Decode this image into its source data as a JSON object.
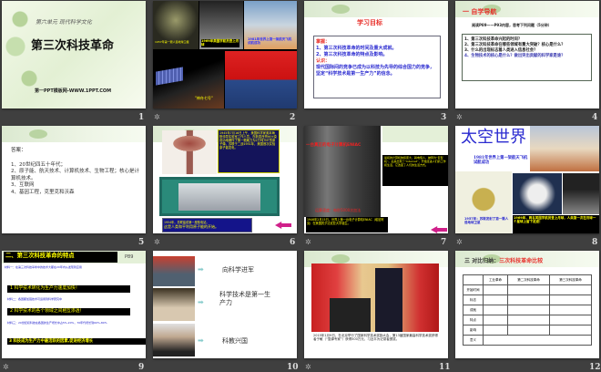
{
  "slides": [
    {
      "num": "1",
      "unit": "第六单元 现代科学文化",
      "title": "第三次科技革命",
      "site": "第一PPT模板网-WWW.1PPT.COM"
    },
    {
      "num": "2",
      "cap1": "1957年第一颗人造地球卫星",
      "cap2": "1969年美国宇航员登上月球",
      "cap3": "1981年世界上第一架航天飞机试航成功",
      "cap4": "\"神舟七号\""
    },
    {
      "num": "3",
      "title": "学习目标",
      "l1": "掌握：",
      "l2": "1、第三次科技革命的时间及重大成就。",
      "l3": "2、第三次科技革命的特点及影响。",
      "l4": "认识：",
      "l5": "现代国际间的竞争已成为以科技为先导的综合国力的竞争，坚定“科学技术是第一生产力”的信念。"
    },
    {
      "num": "4",
      "title": "一 自学导航",
      "sub": "阅读P89——P93内容，思考下列问题（5分钟）",
      "q1": "1、第三次科技革命兴起的时间？",
      "q2": "2、第三次科技革命在哪些领域有重大突破？核心是什么？",
      "q3": "3、什么的出现标志着人类进入信息社会？",
      "q4": "4、生物技术的核心是什么？做出突出贡献的科学家是谁？"
    },
    {
      "num": "5",
      "head": "答案：",
      "a1": "1、20世纪四五十年代；",
      "a2": "2、原子能、航天技术、计算机技术、生物工程；核心是计算机技术。",
      "a3": "3、互联网",
      "a4": "4、基因工程，克里克和沃森"
    },
    {
      "num": "6",
      "txt1": "1945年7月16日上午，美国科学家奥本海默领导实验室工作人员，在新墨西哥州沙漠成功地爆炸了第一颗威力为2万吨TNT的原子弹。苏联于二战1951年，美国首次实验原子能发电。",
      "txt2": "1954年，苏联建成第一座核电站。",
      "txt3": "这是人类和平利用原子能的开始。"
    },
    {
      "num": "7",
      "ttl": "一台真正的电子计算机ENIAC",
      "cap": "运算速度：每秒5000次加法",
      "txt1": "最初的计算机体积庞大，耗电惊人，被称为“巨型机”。后来出现了“Internet”，开始走进人们的工作和生活，它改变了人们的生活方式。",
      "txt2": "1946年2月15日，世界上第一台电子计算机ENIAC（埃尼阿克）在美国宾夕法尼亚大学诞生。"
    },
    {
      "num": "8",
      "title": "太空世界",
      "cap1": "1981年世界上第一架航天飞机试航成功",
      "cap2": "1957年：苏联发射了第一颗人造地球卫星",
      "cap3": "1969年，两名美国宇航员登上月球，人类第一次在月球一个星球上留下足迹！"
    },
    {
      "num": "9",
      "title": "二、第三次科技革命的特点",
      "page": "P89",
      "m1": "材料一：在第三次科技革命中的技术大都在20年内从发现到应用",
      "p1": "1 科学技术转化为生产力速度加快！",
      "m2": "材料二：各国都加强技术可运用到科学研究中",
      "p2": "2 科学技术的各个领域之间相互渗透！",
      "m3": "材料三：20世纪初科技在各国的生产增长中占5%-20%，70年代增长到60%-80%",
      "p3": "3 科技成为生产力中最活跃的因素,促进经济增长"
    },
    {
      "num": "10",
      "s1": "向科学进军",
      "s2": "科学技术是第一生产力",
      "s3": "科教兴国"
    },
    {
      "num": "11",
      "cap": "2015年1月9日，在北京举行了国家科学技术奖励大会，第13届国家最高科学技术奖获得者于敏（“氢弹专家”）获得500万元，习近平为记录者颁奖。"
    },
    {
      "num": "12",
      "title_a": "三 对比归纳：",
      "title_b": "三次科技革命比较",
      "cols": [
        "",
        "工业革命",
        "第二次科技革命",
        "第三次科技革命"
      ],
      "rows": [
        "开始时间",
        "标志",
        "成就",
        "特点",
        "影响",
        "意义"
      ]
    }
  ],
  "colors": {
    "bg": "#3f3f3f",
    "accent_red": "#e8302a",
    "blue": "#2a2ad0"
  }
}
